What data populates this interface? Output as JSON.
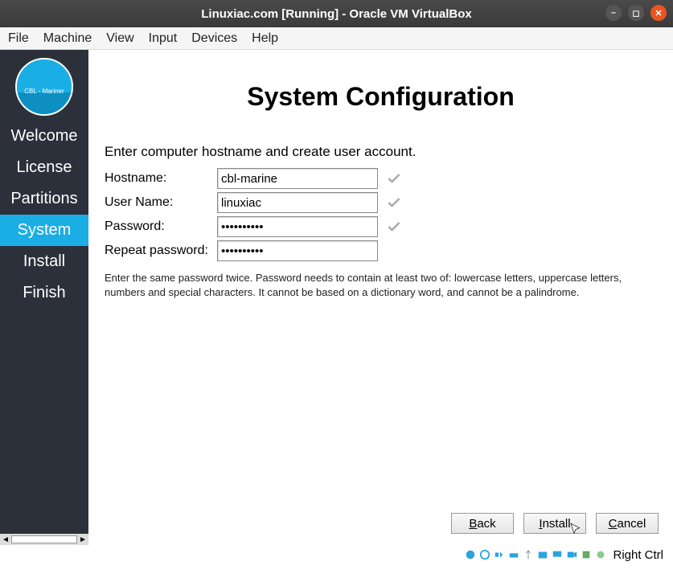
{
  "window": {
    "title": "Linuxiac.com [Running] - Oracle VM VirtualBox"
  },
  "menubar": [
    "File",
    "Machine",
    "View",
    "Input",
    "Devices",
    "Help"
  ],
  "sidebar": {
    "logo_text": "CBL - Mariner",
    "items": [
      "Welcome",
      "License",
      "Partitions",
      "System",
      "Install",
      "Finish"
    ],
    "active_index": 3
  },
  "page": {
    "heading": "System Configuration",
    "intro": "Enter computer hostname and create user account.",
    "fields": {
      "hostname_label": "Hostname:",
      "hostname_value": "cbl-marine",
      "username_label": "User Name:",
      "username_value": "linuxiac",
      "password_label": "Password:",
      "password_value": "••••••••••",
      "repeat_label": "Repeat password:",
      "repeat_value": "••••••••••"
    },
    "hint": "Enter the same password twice. Password needs to contain at least two of: lowercase letters, uppercase letters, numbers and special characters. It cannot be based on a dictionary word, and cannot be a palindrome."
  },
  "buttons": {
    "back": "Back",
    "install": "Install",
    "cancel": "Cancel"
  },
  "statusbar": {
    "host_key": "Right Ctrl"
  }
}
